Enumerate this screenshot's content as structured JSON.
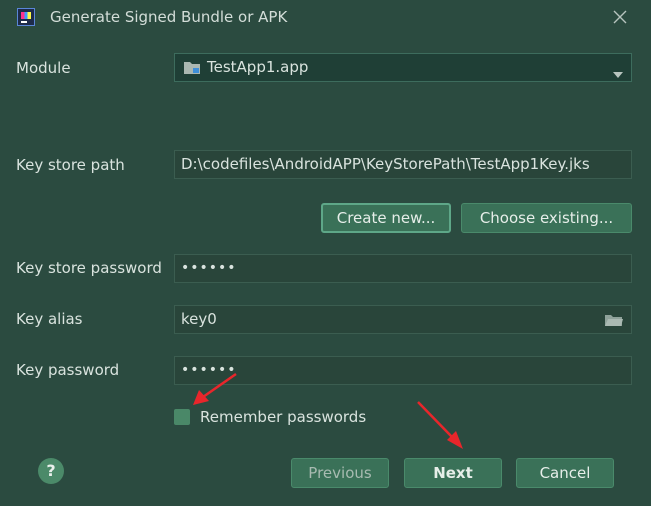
{
  "window": {
    "title": "Generate Signed Bundle or APK",
    "icon": "intellij-app-icon",
    "close_icon": "close-icon"
  },
  "module": {
    "label": "Module",
    "value": "TestApp1.app",
    "icon": "module-folder-icon"
  },
  "keystore": {
    "path_label": "Key store path",
    "path_value": "D:\\codefiles\\AndroidAPP\\KeyStorePath\\TestApp1Key.jks",
    "create_new_label": "Create new...",
    "choose_existing_label": "Choose existing...",
    "password_label": "Key store password",
    "password_value": "••••••"
  },
  "key": {
    "alias_label": "Key alias",
    "alias_value": "key0",
    "password_label": "Key password",
    "password_value": "••••••"
  },
  "remember": {
    "label": "Remember passwords",
    "checked": false
  },
  "footer": {
    "help_label": "?",
    "previous_label": "Previous",
    "next_label": "Next",
    "cancel_label": "Cancel"
  },
  "colors": {
    "background": "#2b4b40",
    "button": "#3a7158",
    "annotation_arrow": "#e8262b"
  }
}
